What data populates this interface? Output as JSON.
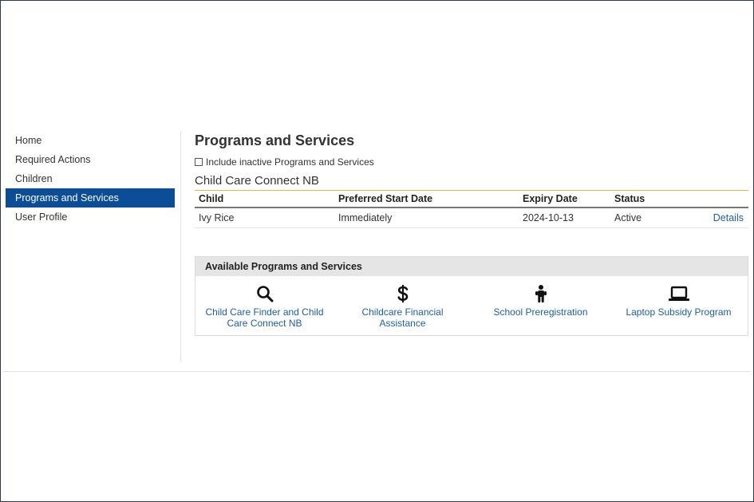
{
  "sidebar": {
    "items": [
      {
        "label": "Home",
        "active": false
      },
      {
        "label": "Required Actions",
        "active": false
      },
      {
        "label": "Children",
        "active": false
      },
      {
        "label": "Programs and Services",
        "active": true
      },
      {
        "label": "User Profile",
        "active": false
      }
    ]
  },
  "main": {
    "title": "Programs and Services",
    "include_inactive_label": "Include inactive Programs and Services",
    "section_title": "Child Care Connect NB",
    "table": {
      "headers": [
        "Child",
        "Preferred Start Date",
        "Expiry Date",
        "Status"
      ],
      "rows": [
        {
          "child": "Ivy Rice",
          "start": "Immediately",
          "expiry": "2024-10-13",
          "status": "Active",
          "action": "Details"
        }
      ]
    },
    "available": {
      "title": "Available Programs and Services",
      "items": [
        {
          "label": "Child Care Finder and Child Care Connect NB",
          "icon": "search-icon"
        },
        {
          "label": "Childcare Financial Assistance",
          "icon": "dollar-icon"
        },
        {
          "label": "School Preregistration",
          "icon": "child-icon"
        },
        {
          "label": "Laptop Subsidy Program",
          "icon": "laptop-icon"
        }
      ]
    }
  },
  "colors": {
    "accent": "#0b4d97",
    "link": "#1f5ea8",
    "section_underline": "#e0b84a"
  }
}
